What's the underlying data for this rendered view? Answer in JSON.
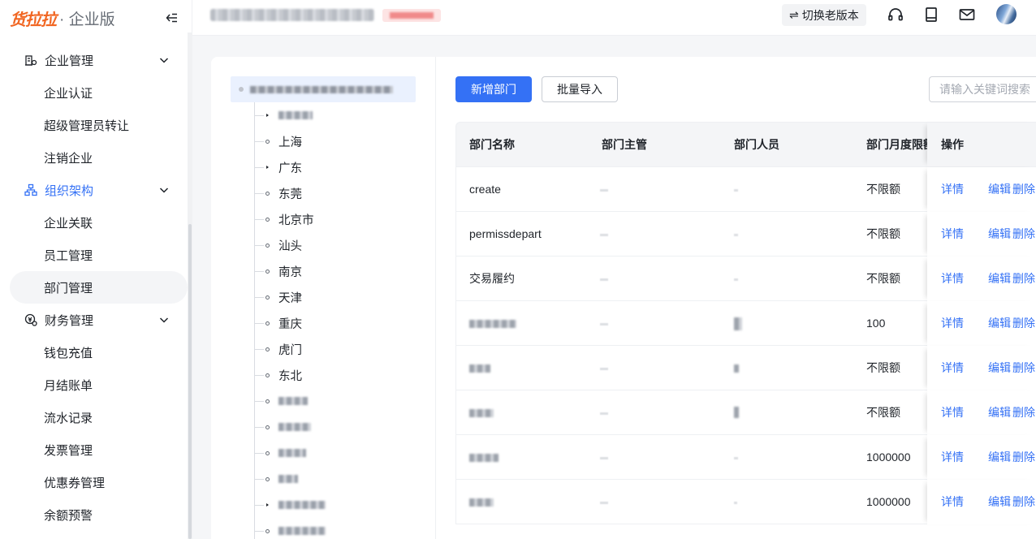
{
  "brand": {
    "logo": "货拉拉",
    "edition": "· 企业版"
  },
  "sidebar": {
    "groups": [
      {
        "label": "企业管理",
        "active": false,
        "items": [
          "企业认证",
          "超级管理员转让",
          "注销企业"
        ]
      },
      {
        "label": "组织架构",
        "active": true,
        "items": [
          "企业关联",
          "员工管理",
          "部门管理"
        ]
      },
      {
        "label": "财务管理",
        "active": false,
        "items": [
          "钱包充值",
          "月结账单",
          "流水记录",
          "发票管理",
          "优惠券管理",
          "余额预警"
        ]
      }
    ],
    "selected_item": "部门管理"
  },
  "header": {
    "switch_label": "切换老版本",
    "switch_icon": "⇌"
  },
  "tree": {
    "nodes": [
      "",
      "上海",
      "广东",
      "东莞",
      "北京市",
      "汕头",
      "南京",
      "天津",
      "重庆",
      "虎门",
      "东北",
      "",
      "",
      "",
      "",
      "",
      ""
    ]
  },
  "toolbar": {
    "add_label": "新增部门",
    "import_label": "批量导入",
    "search_placeholder": "请输入关键词搜索"
  },
  "table": {
    "columns": [
      "部门名称",
      "部门主管",
      "部门人员",
      "部门月度限额",
      "操作"
    ],
    "rows": [
      {
        "name": "create",
        "limit": "不限额"
      },
      {
        "name": "permissdepart",
        "limit": "不限额"
      },
      {
        "name": "交易履约",
        "limit": "不限额"
      },
      {
        "name": "",
        "limit": "100"
      },
      {
        "name": "",
        "limit": "不限额"
      },
      {
        "name": "",
        "limit": "不限额"
      },
      {
        "name": "",
        "limit": "1000000"
      },
      {
        "name": "",
        "limit": "1000000"
      }
    ],
    "ops": {
      "detail": "详情",
      "edit": "编辑",
      "delete": "删除"
    }
  },
  "colors": {
    "accent": "#3471f5",
    "brand": "#f16622"
  }
}
